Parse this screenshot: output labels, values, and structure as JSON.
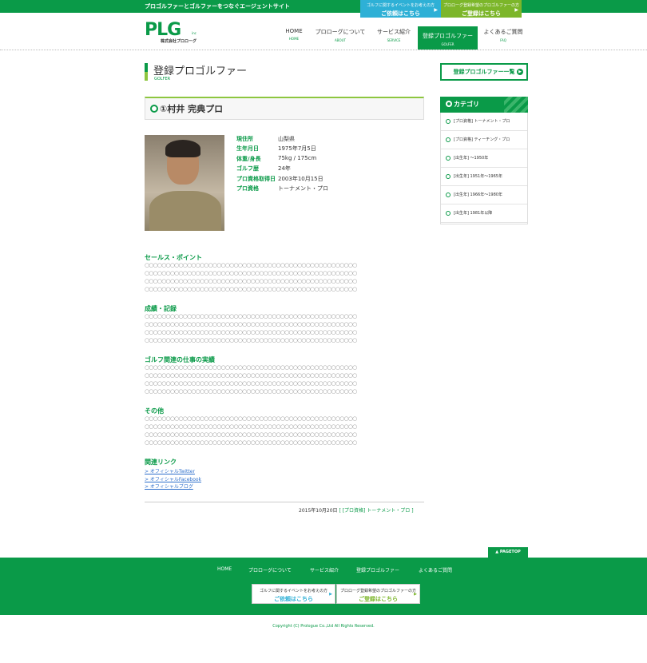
{
  "header": {
    "tagline": "プロゴルファーとゴルファーをつなぐエージェントサイト",
    "top_buttons": [
      {
        "small": "ゴルフに関するイベントをお考えの方",
        "big": "ご依頼はこちら",
        "color": "#2eb0d6"
      },
      {
        "small": "プロローグ登録希望のプロゴルファーの方",
        "big": "ご登録はこちら",
        "color": "#7cb62a"
      }
    ],
    "logo": {
      "letters": "PLG",
      "inc": "inc",
      "corp": "株式会社プロローグ"
    },
    "nav": [
      {
        "label": "HOME",
        "en": "HOME"
      },
      {
        "label": "プロローグについて",
        "en": "ABOUT"
      },
      {
        "label": "サービス紹介",
        "en": "SERVICE"
      },
      {
        "label": "登録プロゴルファー",
        "en": "GOLFER"
      },
      {
        "label": "よくあるご質問",
        "en": "FAQ"
      }
    ]
  },
  "page": {
    "title": "登録プロゴルファー",
    "subtitle": "GOLFER",
    "list_button": "登録プロゴルファー一覧",
    "golfer_name": "①村井 完典プロ"
  },
  "profile": [
    {
      "key": "現住所",
      "value": "山梨県"
    },
    {
      "key": "生年月日",
      "value": "1975年7月5日"
    },
    {
      "key": "体重/身長",
      "value": "75kg / 175cm"
    },
    {
      "key": "ゴルフ歴",
      "value": "24年"
    },
    {
      "key": "プロ資格取得日",
      "value": "2003年10月15日"
    },
    {
      "key": "プロ資格",
      "value": "トーナメント・プロ"
    }
  ],
  "sections": [
    {
      "heading": "セールス・ポイント"
    },
    {
      "heading": "成績・記録"
    },
    {
      "heading": "ゴルフ関連の仕事の実績"
    },
    {
      "heading": "その他"
    }
  ],
  "placeholder_line": "○○○○○○○○○○○○○○○○○○○○○○○○○○○○○○○○○○○○○○○○○○○○○○○○○○",
  "links": {
    "heading": "関連リンク",
    "items": [
      "> オフィシャルTwitter",
      "> オフィシャルFacebook",
      "> オフィシャルブログ"
    ]
  },
  "post_meta": {
    "date": "2015年10月20日",
    "category": "[ [プロ資格] トーナメント・プロ ]"
  },
  "sidebar": {
    "category_title": "カテゴリ",
    "categories": [
      "[プロ資格] トーナメント・プロ",
      "[プロ資格] ティーチング・プロ",
      "[出生年] ～1950年",
      "[出生年] 1951年～1965年",
      "[出生年] 1966年～1980年",
      "[出生年] 1981年以降"
    ]
  },
  "footer": {
    "pagetop": "▲ PAGETOP",
    "nav": [
      "HOME",
      "プロローグについて",
      "サービス紹介",
      "登録プロゴルファー",
      "よくあるご質問"
    ],
    "buttons": [
      {
        "small": "ゴルフに関するイベントをお考えの方",
        "big": "ご依頼はこちら",
        "color": "#2eb0d6"
      },
      {
        "small": "プロローグ登録希望のプロゴルファーの方",
        "big": "ご登録はこちら",
        "color": "#7cb62a"
      }
    ],
    "copyright": "Copyright (C) Prologue Co.,Ltd All Rights Reserved."
  },
  "icons": {
    "arrow": "▶"
  }
}
